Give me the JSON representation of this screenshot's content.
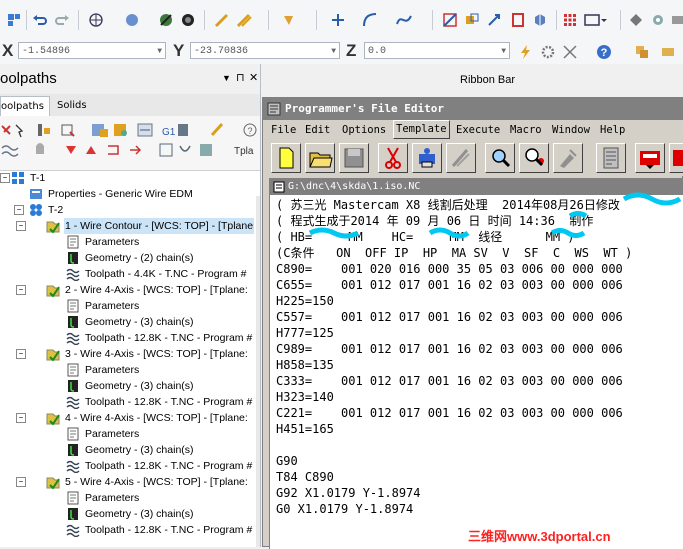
{
  "coords": {
    "x_label": "X",
    "x_value": "-1.54896",
    "y_label": "Y",
    "y_value": "-23.70836",
    "z_label": "Z",
    "z_value": "0.0"
  },
  "ribbon_bar_label": "Ribbon Bar",
  "panel": {
    "title": "oolpaths",
    "pin": "▼",
    "pin2": "⊓",
    "close": "✕",
    "tabs": [
      "oolpaths",
      "Solids"
    ]
  },
  "tree": [
    {
      "label": "T-1",
      "indent": 0,
      "icon": "grid-icon"
    },
    {
      "label": "Properties - Generic Wire EDM",
      "indent": 1,
      "icon": "properties-icon"
    },
    {
      "label": "T-2",
      "indent": 1,
      "icon": "group-icon"
    },
    {
      "label": "1 - Wire Contour - [WCS: TOP] - [Tplane",
      "indent": 2,
      "icon": "operation-icon",
      "highlight": true
    },
    {
      "label": "Parameters",
      "indent": 3,
      "icon": "parameters-icon"
    },
    {
      "label": "Geometry - (2) chain(s)",
      "indent": 3,
      "icon": "geometry-icon"
    },
    {
      "label": "Toolpath - 4.4K - T.NC - Program #",
      "indent": 3,
      "icon": "toolpath-icon"
    },
    {
      "label": "2 - Wire 4-Axis - [WCS: TOP] - [Tplane:",
      "indent": 2,
      "icon": "operation-icon"
    },
    {
      "label": "Parameters",
      "indent": 3,
      "icon": "parameters-icon"
    },
    {
      "label": "Geometry - (3) chain(s)",
      "indent": 3,
      "icon": "geometry-icon"
    },
    {
      "label": "Toolpath - 12.8K - T.NC - Program #",
      "indent": 3,
      "icon": "toolpath-icon"
    },
    {
      "label": "3 - Wire 4-Axis - [WCS: TOP] - [Tplane:",
      "indent": 2,
      "icon": "operation-icon"
    },
    {
      "label": "Parameters",
      "indent": 3,
      "icon": "parameters-icon"
    },
    {
      "label": "Geometry - (3) chain(s)",
      "indent": 3,
      "icon": "geometry-icon"
    },
    {
      "label": "Toolpath - 12.8K - T.NC - Program #",
      "indent": 3,
      "icon": "toolpath-icon"
    },
    {
      "label": "4 - Wire 4-Axis - [WCS: TOP] - [Tplane:",
      "indent": 2,
      "icon": "operation-icon"
    },
    {
      "label": "Parameters",
      "indent": 3,
      "icon": "parameters-icon"
    },
    {
      "label": "Geometry - (3) chain(s)",
      "indent": 3,
      "icon": "geometry-icon"
    },
    {
      "label": "Toolpath - 12.8K - T.NC - Program #",
      "indent": 3,
      "icon": "toolpath-icon"
    },
    {
      "label": "5 - Wire 4-Axis - [WCS: TOP] - [Tplane:",
      "indent": 2,
      "icon": "operation-icon"
    },
    {
      "label": "Parameters",
      "indent": 3,
      "icon": "parameters-icon"
    },
    {
      "label": "Geometry - (3) chain(s)",
      "indent": 3,
      "icon": "geometry-icon"
    },
    {
      "label": "Toolpath - 12.8K - T.NC - Program #",
      "indent": 3,
      "icon": "toolpath-icon"
    }
  ],
  "editor": {
    "title": "Programmer's File Editor",
    "menu": [
      "File",
      "Edit",
      "Options",
      "Template",
      "Execute",
      "Macro",
      "Window",
      "Help"
    ],
    "doc_title": "G:\\dnc\\4\\skda\\1.iso.NC",
    "lines": [
      "( 苏三光 Mastercam X8 线割后处理  2014年08月26日修改",
      "( 程式生成于2014 年 09 月 06 日 时间 14:36  制作",
      "( HB=     MM    HC=     MM  线径      MM )",
      "(C条件   ON  OFF IP  HP  MA SV  V  SF  C  WS  WT )",
      "C890=    001 020 016 000 35 05 03 006 00 000 000",
      "C655=    001 012 017 001 16 02 03 003 00 000 006",
      "H225=150",
      "C557=    001 012 017 001 16 02 03 003 00 000 006",
      "H777=125",
      "C989=    001 012 017 001 16 02 03 003 00 000 006",
      "H858=135",
      "C333=    001 012 017 001 16 02 03 003 00 000 006",
      "H323=140",
      "C221=    001 012 017 001 16 02 03 003 00 000 006",
      "H451=165",
      "",
      "G90",
      "T84 C890",
      "G92 X1.0179 Y-1.8974",
      "G0 X1.0179 Y-1.8974"
    ]
  },
  "watermark": "三维网www.3dportal.cn",
  "colors": {
    "editor_titlebar": "#808080",
    "tree_highlight": "#cce4f7",
    "watermark": "#ff2020"
  }
}
